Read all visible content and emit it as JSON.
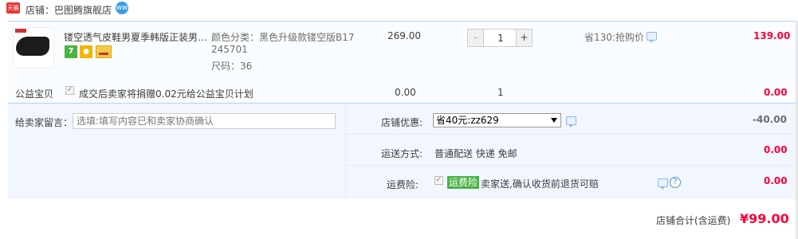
{
  "shop": {
    "badge": "天猫",
    "name": "店铺：巴图腾旗舰店",
    "wangwang_badge": "ww"
  },
  "item": {
    "title": "镂空透气皮鞋男夏季韩版正装男…",
    "sku_color": "颜色分类：黑色升级款镂空版B17",
    "sku_color2": "245701",
    "sku_size": "尺码：36",
    "service_icons": [
      "seven-day-return-icon",
      "guarantee-icon",
      "credit-card-icon"
    ],
    "service_green_glyph": "7",
    "price": "269.00",
    "quantity": "1",
    "minus": "-",
    "plus": "+",
    "promo": "省130:抢购价",
    "total": "139.00"
  },
  "charity": {
    "label": "公益宝贝",
    "checked": "✓",
    "text": "成交后卖家将捐赠0.02元给公益宝贝计划",
    "price": "0.00",
    "quantity": "1",
    "total": "0.00"
  },
  "message": {
    "label": "给卖家留言：",
    "placeholder": "选填:填写内容已和卖家协商确认"
  },
  "coupon": {
    "label": "店铺优惠:",
    "selected": "省40元:zz629",
    "amount": "-40.00"
  },
  "shipping": {
    "label": "运送方式:",
    "method": "普通配送 快递 免邮",
    "amount": "0.00"
  },
  "insurance": {
    "label": "运费险:",
    "checked": "✓",
    "tag": "运费险",
    "text": "卖家送,确认收货前退货可赔",
    "help": "?",
    "amount": "0.00"
  },
  "footer": {
    "label": "店铺合计(含运费)",
    "total": "¥99.00"
  },
  "colors": {
    "accent_red": "#ff0036",
    "border_blue": "#b2d1ff",
    "bg_light_blue": "#f2f7ff",
    "tmall_red": "#e4393c",
    "green_tag": "#4ab344"
  }
}
